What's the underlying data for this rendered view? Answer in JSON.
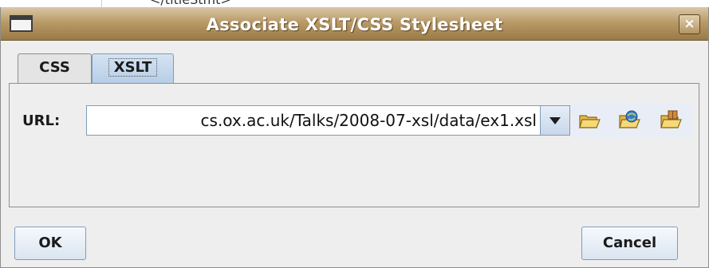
{
  "background_snippet": "</titleStmt>",
  "dialog": {
    "title": "Associate XSLT/CSS Stylesheet",
    "close_symbol": "×"
  },
  "tabs": [
    {
      "label": "CSS",
      "selected": false
    },
    {
      "label": "XSLT",
      "selected": true
    }
  ],
  "url": {
    "label": "URL:",
    "value": "cs.ox.ac.uk/Talks/2008-07-xsl/data/ex1.xsl"
  },
  "icons": {
    "dropdown": "chevron-down-icon",
    "browse_local": "folder-open-icon",
    "browse_url": "folder-url-icon",
    "browse_archive": "folder-archive-icon"
  },
  "buttons": {
    "ok": "OK",
    "cancel": "Cancel"
  },
  "colors": {
    "titlebar": "#b99b68",
    "accent": "#7f9db9",
    "background": "#eeeeee"
  }
}
